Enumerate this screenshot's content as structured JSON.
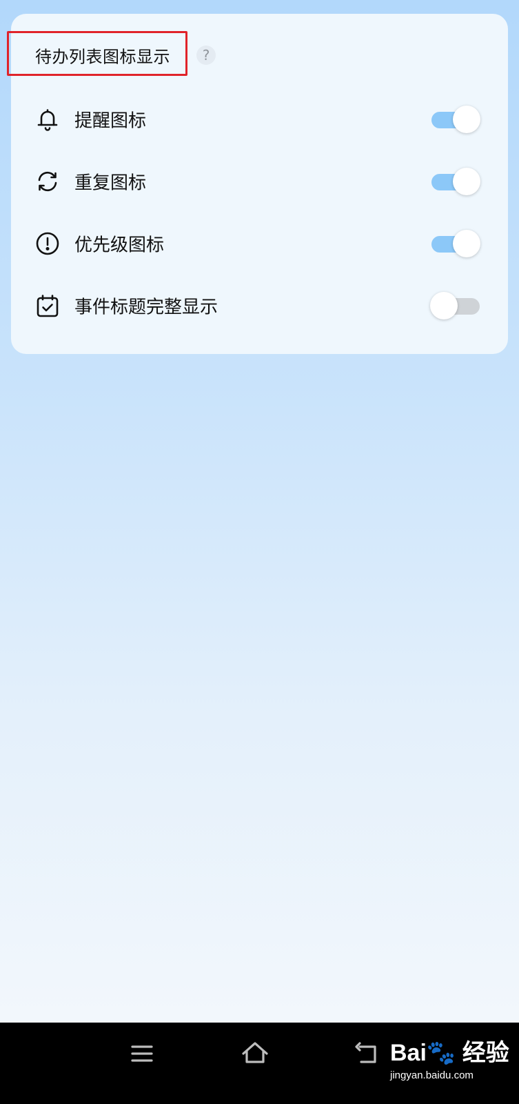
{
  "section": {
    "title": "待办列表图标显示",
    "help_glyph": "?"
  },
  "rows": [
    {
      "label": "提醒图标",
      "icon": "bell-icon",
      "enabled": true
    },
    {
      "label": "重复图标",
      "icon": "repeat-icon",
      "enabled": true
    },
    {
      "label": "优先级图标",
      "icon": "priority-icon",
      "enabled": true
    },
    {
      "label": "事件标题完整显示",
      "icon": "calendar-check-icon",
      "enabled": false
    }
  ],
  "colors": {
    "toggle_on": "#8cc8f8",
    "toggle_off": "#cfd3d7",
    "highlight": "#e0232a"
  },
  "nav": {
    "buttons": [
      "menu-icon",
      "home-icon",
      "back-icon"
    ]
  },
  "watermark": {
    "logo": "Bai",
    "logo_suffix": "经验",
    "url": "jingyan.baidu.com"
  }
}
